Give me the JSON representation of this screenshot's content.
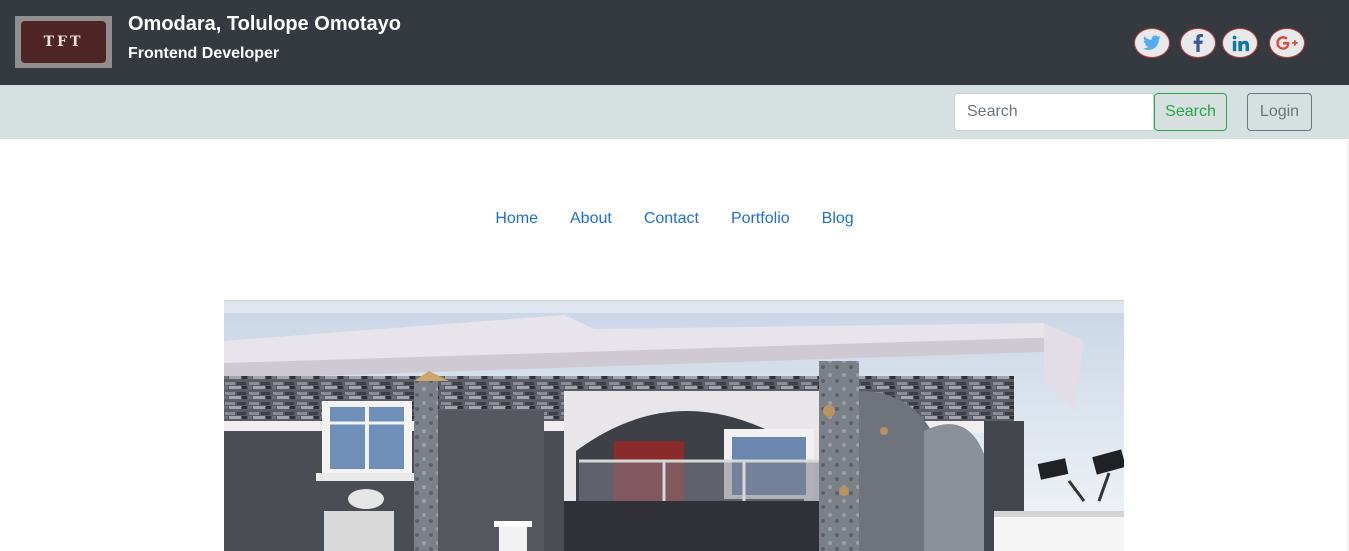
{
  "header": {
    "logo_text": "TFT",
    "name": "Omodara, Tolulope Omotayo",
    "role": "Frontend Developer",
    "social": [
      {
        "icon": "twitter-icon",
        "color": "#55acee"
      },
      {
        "icon": "facebook-icon",
        "color": "#3b5998"
      },
      {
        "icon": "linkedin-icon",
        "color": "#0e76a8"
      },
      {
        "icon": "google-plus-icon",
        "color": "#dd4b39"
      }
    ]
  },
  "toolbar": {
    "search_placeholder": "Search",
    "search_value": "",
    "search_button": "Search",
    "login_button": "Login"
  },
  "nav": {
    "items": [
      "Home",
      "About",
      "Contact",
      "Portfolio",
      "Blog"
    ]
  },
  "hero": {
    "alt": "house-photo"
  },
  "colors": {
    "header_bg": "#343a40",
    "band_bg": "#d6e0e0",
    "link": "#1f6fd1",
    "success": "#28a745",
    "secondary": "#6c757d"
  }
}
